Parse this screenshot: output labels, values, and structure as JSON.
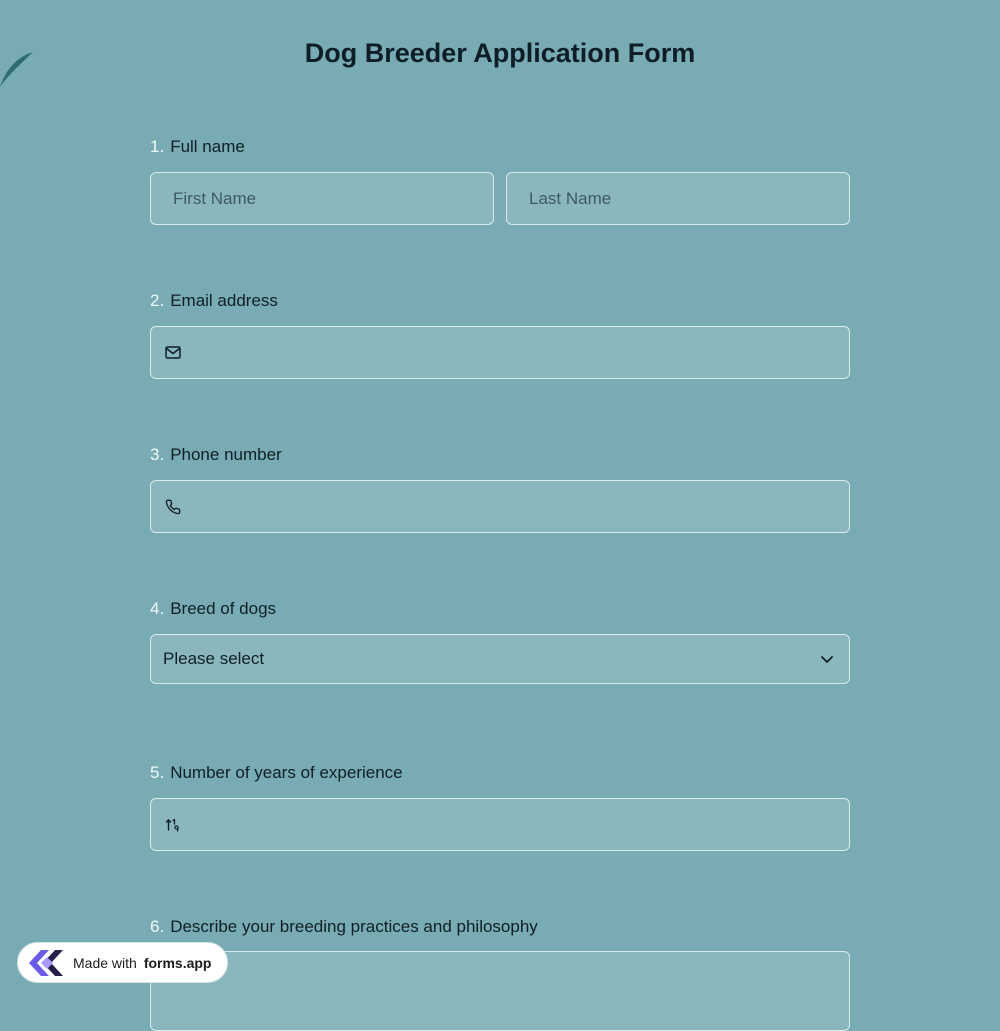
{
  "form": {
    "title": "Dog Breeder Application Form"
  },
  "questions": [
    {
      "number": "1.",
      "label": "Full name",
      "first_placeholder": "First Name",
      "last_placeholder": "Last Name"
    },
    {
      "number": "2.",
      "label": "Email address",
      "icon": "envelope-icon"
    },
    {
      "number": "3.",
      "label": "Phone number",
      "icon": "phone-icon"
    },
    {
      "number": "4.",
      "label": "Breed of dogs",
      "selected": "Please select",
      "icon": "chevron-down-icon"
    },
    {
      "number": "5.",
      "label": "Number of years of experience",
      "icon": "number-sort-icon"
    },
    {
      "number": "6.",
      "label": "Describe your breeding practices and philosophy"
    }
  ],
  "badge": {
    "prefix": "Made with",
    "brand": "forms.app"
  },
  "colors": {
    "background": "#78abb3",
    "field_background": "#8ab7bd",
    "field_border": "#d9eaed",
    "number_color": "#f2f8f9",
    "text": "#0f1f26",
    "leaf": "#2f6c73",
    "brand_purple": "#6b5ce7"
  }
}
